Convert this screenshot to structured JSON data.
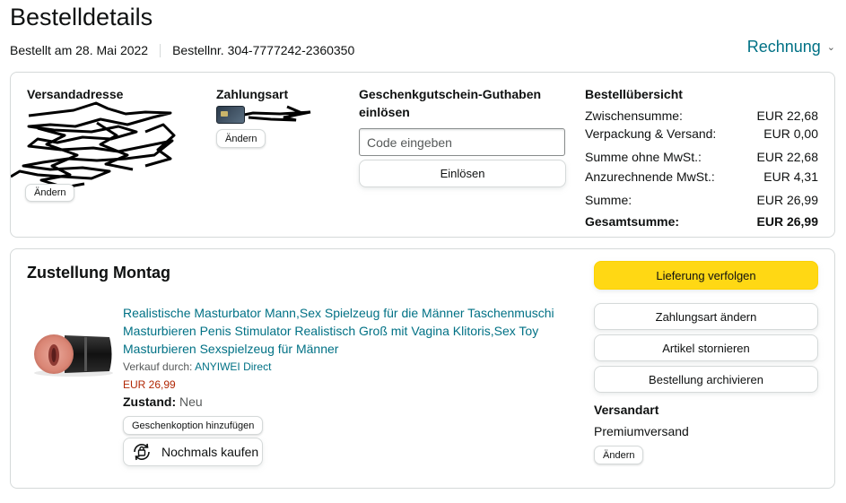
{
  "page": {
    "title": "Bestelldetails",
    "ordered_on": "Bestellt am 28. Mai 2022",
    "order_number": "Bestellnr. 304-7777242-2360350",
    "invoice_label": "Rechnung",
    "invoice_icon": "chevron-down-icon"
  },
  "address": {
    "title": "Versandadresse",
    "change_label": "Ändern"
  },
  "payment": {
    "title": "Zahlungsart",
    "card_icon": "credit-card-icon",
    "change_label": "Ändern"
  },
  "giftcard": {
    "title_line1": "Geschenkgutschein-Guthaben",
    "title_line2": "einlösen",
    "placeholder": "Code eingeben",
    "redeem_label": "Einlösen"
  },
  "summary": {
    "title": "Bestellübersicht",
    "rows": [
      {
        "label": "Zwischensumme:",
        "value": "EUR 22,68"
      },
      {
        "label": "Verpackung & Versand:",
        "value": "EUR 0,00"
      },
      {
        "label": "Summe ohne MwSt.:",
        "value": "EUR 22,68"
      },
      {
        "label": "Anzurechnende MwSt.:",
        "value": "EUR 4,31"
      },
      {
        "label": "Summe:",
        "value": "EUR 26,99"
      },
      {
        "label": "Gesamtsumme:",
        "value": "EUR 26,99"
      }
    ]
  },
  "delivery": {
    "title": "Zustellung Montag",
    "product": {
      "title_line1": "Realistische Masturbator Mann,Sex Spielzeug für die Männer Taschenmuschi",
      "title_line2": "Masturbieren Penis Stimulator Realistisch Groß mit Vagina Klitoris,Sex Toy",
      "title_line3": "Masturbieren Sexspielzeug für Männer",
      "sold_by_label": "Verkauf durch:",
      "seller": "ANYIWEI Direct",
      "price": "EUR 26,99",
      "condition_label": "Zustand:",
      "condition_value": "Neu",
      "gift_option_label": "Geschenkoption hinzufügen",
      "buy_again_label": "Nochmals kaufen",
      "buy_again_icon": "buy-again-icon"
    },
    "actions": {
      "track": "Lieferung verfolgen",
      "change_payment": "Zahlungsart ändern",
      "cancel": "Artikel stornieren",
      "archive": "Bestellung archivieren"
    },
    "shipping": {
      "title": "Versandart",
      "value": "Premiumversand",
      "change_label": "Ändern"
    }
  },
  "colors": {
    "link": "#007185",
    "price": "#b12704",
    "primary_button": "#ffd814",
    "border": "#d5d9d9"
  }
}
